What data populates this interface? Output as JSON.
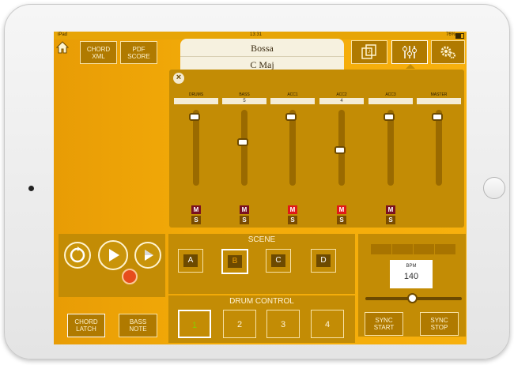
{
  "status": {
    "device": "iPad",
    "time": "13:31",
    "battery": "76%"
  },
  "top": {
    "chord_xml": "CHORD\nXML",
    "pdf_score": "PDF\nSCORE"
  },
  "song": {
    "style": "Bossa",
    "key": "C Maj"
  },
  "icons": {
    "home": "home-icon",
    "songbook": "songbook-icon",
    "mixer": "mixer-icon",
    "settings": "gear-icon",
    "close": "close-icon"
  },
  "mixer": {
    "close_label": "×",
    "channels": [
      {
        "label": "DRUMS",
        "value": "",
        "level": 0.95,
        "mute": "M",
        "solo": "S",
        "mute_active": false
      },
      {
        "label": "BASS",
        "value": "5",
        "level": 0.58,
        "mute": "M",
        "solo": "S",
        "mute_active": false
      },
      {
        "label": "ACC1",
        "value": "",
        "level": 0.95,
        "mute": "M",
        "solo": "S",
        "mute_active": true
      },
      {
        "label": "ACC2",
        "value": "4",
        "level": 0.47,
        "mute": "M",
        "solo": "S",
        "mute_active": true
      },
      {
        "label": "ACC3",
        "value": "",
        "level": 0.95,
        "mute": "M",
        "solo": "S",
        "mute_active": false
      },
      {
        "label": "MASTER",
        "value": "",
        "level": 0.95,
        "mute": "",
        "solo": "",
        "mute_active": false
      }
    ]
  },
  "scene": {
    "title": "SCENE",
    "buttons": [
      "A",
      "B",
      "C",
      "D"
    ],
    "selected": "B"
  },
  "drum_control": {
    "title": "DRUM CONTROL",
    "buttons": [
      "1",
      "2",
      "3",
      "4"
    ],
    "selected": "1"
  },
  "tempo": {
    "bpm_label": "BPM",
    "bpm_value": "140",
    "slider_level": 0.48
  },
  "bottom_left": {
    "chord_latch": "CHORD\nLATCH",
    "bass_note": "BASS\nNOTE"
  },
  "bottom_right": {
    "sync_start": "SYNC\nSTART",
    "sync_stop": "SYNC\nSTOP"
  },
  "colors": {
    "accent": "#f2aa08",
    "panel": "#c38c05",
    "mute_active": "#e01818",
    "mute_idle": "#7a1020"
  }
}
